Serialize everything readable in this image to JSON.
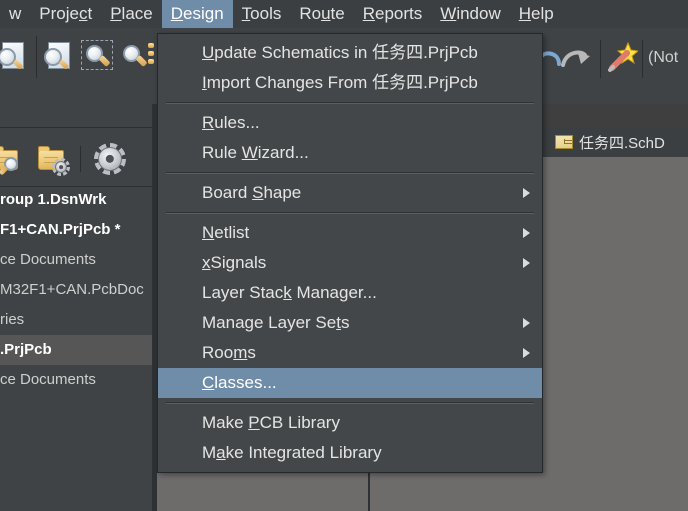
{
  "menubar": {
    "items": [
      {
        "label": "w",
        "accel": "",
        "active": false,
        "name": "menubar-item-view"
      },
      {
        "label": "Project",
        "accel": "c",
        "active": false,
        "name": "menubar-item-project"
      },
      {
        "label": "Place",
        "accel": "P",
        "active": false,
        "name": "menubar-item-place"
      },
      {
        "label": "Design",
        "accel": "D",
        "active": true,
        "name": "menubar-item-design"
      },
      {
        "label": "Tools",
        "accel": "T",
        "active": false,
        "name": "menubar-item-tools"
      },
      {
        "label": "Route",
        "accel": "u",
        "active": false,
        "name": "menubar-item-route"
      },
      {
        "label": "Reports",
        "accel": "R",
        "active": false,
        "name": "menubar-item-reports"
      },
      {
        "label": "Window",
        "accel": "W",
        "active": false,
        "name": "menubar-item-window"
      },
      {
        "label": "Help",
        "accel": "H",
        "active": false,
        "name": "menubar-item-help"
      }
    ]
  },
  "toolbar": {
    "status_text": "(Not",
    "icons": [
      "zoom-document-icon",
      "zoom-document-fit-icon",
      "zoom-area-icon",
      "zoom-selected-icon",
      "undo-icon",
      "redo-icon",
      "wand-icon"
    ]
  },
  "panel_toolbar": {
    "icons": [
      "folder-search-icon",
      "folder-settings-icon",
      "gear-icon"
    ]
  },
  "left_panel": {
    "rows": [
      {
        "text": "roup 1.DsnWrk",
        "bold": true,
        "selected": false
      },
      {
        "text": "F1+CAN.PrjPcb *",
        "bold": true,
        "selected": false
      },
      {
        "text": "ce Documents",
        "bold": false,
        "selected": false
      },
      {
        "text": "M32F1+CAN.PcbDoc",
        "bold": false,
        "selected": false
      },
      {
        "text": "ries",
        "bold": false,
        "selected": false
      },
      {
        "text": ".PrjPcb",
        "bold": true,
        "selected": true
      },
      {
        "text": "ce Documents",
        "bold": false,
        "selected": false
      }
    ]
  },
  "tabs": [
    {
      "label": "任务四.SchD",
      "icon": "schematic-document-icon",
      "active": false
    }
  ],
  "dropdown": {
    "title": "Design",
    "items": [
      {
        "type": "item",
        "label": "Update Schematics in 任务四.PrjPcb",
        "accel": "U",
        "submenu": false,
        "highlighted": false,
        "name": "menu-item-update-schematics"
      },
      {
        "type": "item",
        "label": "Import Changes From 任务四.PrjPcb",
        "accel": "I",
        "submenu": false,
        "highlighted": false,
        "name": "menu-item-import-changes"
      },
      {
        "type": "separator"
      },
      {
        "type": "item",
        "label": "Rules...",
        "accel": "R",
        "submenu": false,
        "highlighted": false,
        "name": "menu-item-rules"
      },
      {
        "type": "item",
        "label": "Rule Wizard...",
        "accel": "W",
        "submenu": false,
        "highlighted": false,
        "name": "menu-item-rule-wizard"
      },
      {
        "type": "separator"
      },
      {
        "type": "item",
        "label": "Board Shape",
        "accel": "S",
        "submenu": true,
        "highlighted": false,
        "name": "menu-item-board-shape"
      },
      {
        "type": "separator"
      },
      {
        "type": "item",
        "label": "Netlist",
        "accel": "N",
        "submenu": true,
        "highlighted": false,
        "name": "menu-item-netlist"
      },
      {
        "type": "item",
        "label": "xSignals",
        "accel": "x",
        "submenu": true,
        "highlighted": false,
        "name": "menu-item-xsignals"
      },
      {
        "type": "item",
        "label": "Layer Stack Manager...",
        "accel": "k",
        "submenu": false,
        "highlighted": false,
        "name": "menu-item-layer-stack-manager"
      },
      {
        "type": "item",
        "label": "Manage Layer Sets",
        "accel": "t",
        "submenu": true,
        "highlighted": false,
        "name": "menu-item-manage-layer-sets"
      },
      {
        "type": "item",
        "label": "Rooms",
        "accel": "m",
        "submenu": true,
        "highlighted": false,
        "name": "menu-item-rooms"
      },
      {
        "type": "item",
        "label": "Classes...",
        "accel": "C",
        "submenu": false,
        "highlighted": true,
        "name": "menu-item-classes"
      },
      {
        "type": "separator"
      },
      {
        "type": "item",
        "label": "Make PCB Library",
        "accel": "P",
        "submenu": false,
        "highlighted": false,
        "name": "menu-item-make-pcb-library"
      },
      {
        "type": "item",
        "label": "Make Integrated Library",
        "accel": "a",
        "submenu": false,
        "highlighted": false,
        "name": "menu-item-make-integrated-library"
      }
    ]
  },
  "colors": {
    "menu_bg": "#444749",
    "highlight": "#6f8ca8",
    "panel_bg": "#3f4345",
    "canvas_bg": "#6e6b6b",
    "text": "#e4e4e4"
  }
}
